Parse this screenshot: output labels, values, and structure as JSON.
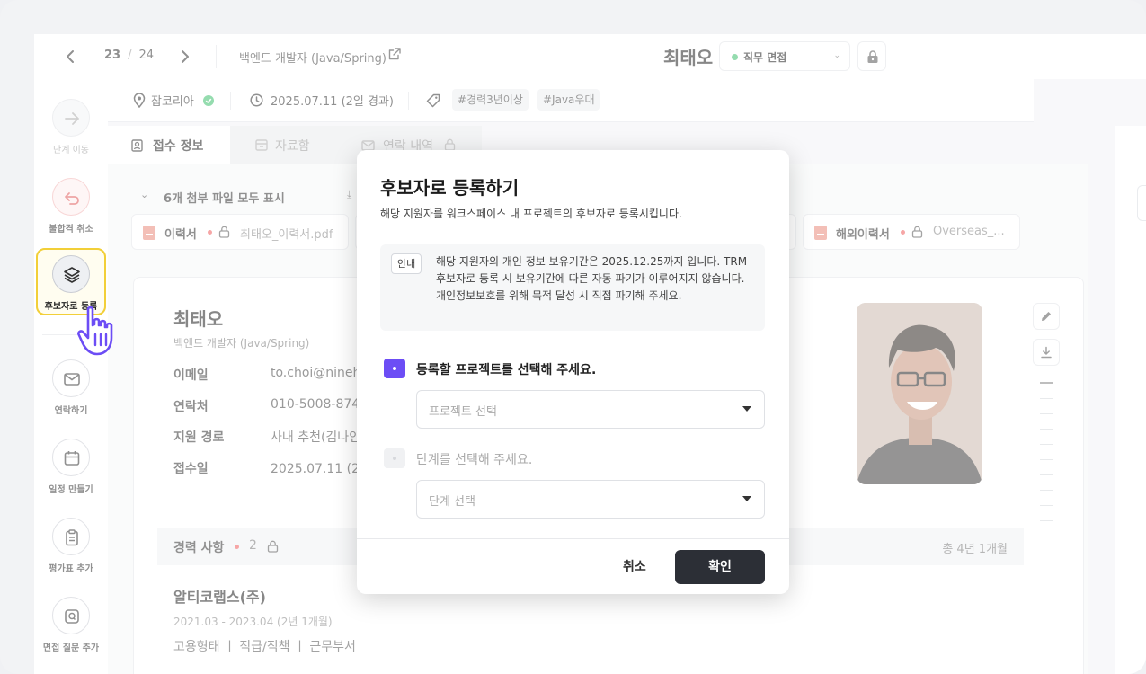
{
  "topbar": {
    "current": "23",
    "separator": "/",
    "total": "24",
    "job_title": "백엔드 개발자 (Java/Spring)",
    "candidate_name": "최태오",
    "stage": "직무 면접"
  },
  "rail": {
    "items": [
      {
        "label": "단계 이동"
      },
      {
        "label": "불합격 취소"
      },
      {
        "label": "후보자로 등록"
      },
      {
        "label": "연락하기"
      },
      {
        "label": "일정 만들기"
      },
      {
        "label": "평가표 추가"
      },
      {
        "label": "면접 질문 추가"
      }
    ]
  },
  "infobar": {
    "source": "잡코리아",
    "date": "2025.07.11 (2일 경과)",
    "tags": [
      "#경력3년이상",
      "#Java우대"
    ]
  },
  "tabs": [
    {
      "label": "접수 정보"
    },
    {
      "label": "자료함"
    },
    {
      "label": "연락 내역"
    }
  ],
  "files": {
    "toggle_label": "6개 첨부 파일 모두 표시",
    "download_label": "모두",
    "chips": [
      {
        "name": "이력서",
        "file": "최태오_이력서.pdf"
      },
      {
        "name": "해외이력서",
        "file": "Overseas_..."
      }
    ]
  },
  "profile": {
    "name": "최태오",
    "role": "백엔드 개발자 (Java/Spring)",
    "rows": [
      {
        "label": "이메일",
        "value": "to.choi@nineh"
      },
      {
        "label": "연락처",
        "value": "010-5008-874"
      },
      {
        "label": "지원 경로",
        "value": "사내 추천(김나인"
      },
      {
        "label": "접수일",
        "value": "2025.07.11 (2일"
      }
    ]
  },
  "experience": {
    "title": "경력 사항",
    "count": "2",
    "total": "총 4년 1개월",
    "company": "알티코랩스(주)",
    "period": "2021.03 - 2023.04 (2년 1개월)",
    "fields": "고용형태  ㅣ 직급/직책  ㅣ 근무부서"
  },
  "modal": {
    "title": "후보자로 등록하기",
    "subtitle": "해당 지원자를 워크스페이스 내 프로젝트의 후보자로 등록시킵니다.",
    "notice_tag": "안내",
    "notice_text": "해당 지원자의 개인 정보 보유기간은 2025.12.25까지 입니다. TRM 후보자로 등록 시 보유기간에 따른 자동 파기가 이루어지지 않습니다. 개인정보보호를 위해 목적 달성 시 직접 파기해 주세요.",
    "step1_label": "등록할 프로젝트를 선택해 주세요.",
    "step1_placeholder": "프로젝트 선택",
    "step2_label": "단계를 선택해 주세요.",
    "step2_placeholder": "단계 선택",
    "cancel_label": "취소",
    "confirm_label": "확인"
  },
  "colors": {
    "accent": "#6c4df5",
    "highlight": "#f2cf38",
    "status_green": "#3bbf6c",
    "alert_red": "#ef5b5b",
    "primary_button": "#2c2f36"
  }
}
